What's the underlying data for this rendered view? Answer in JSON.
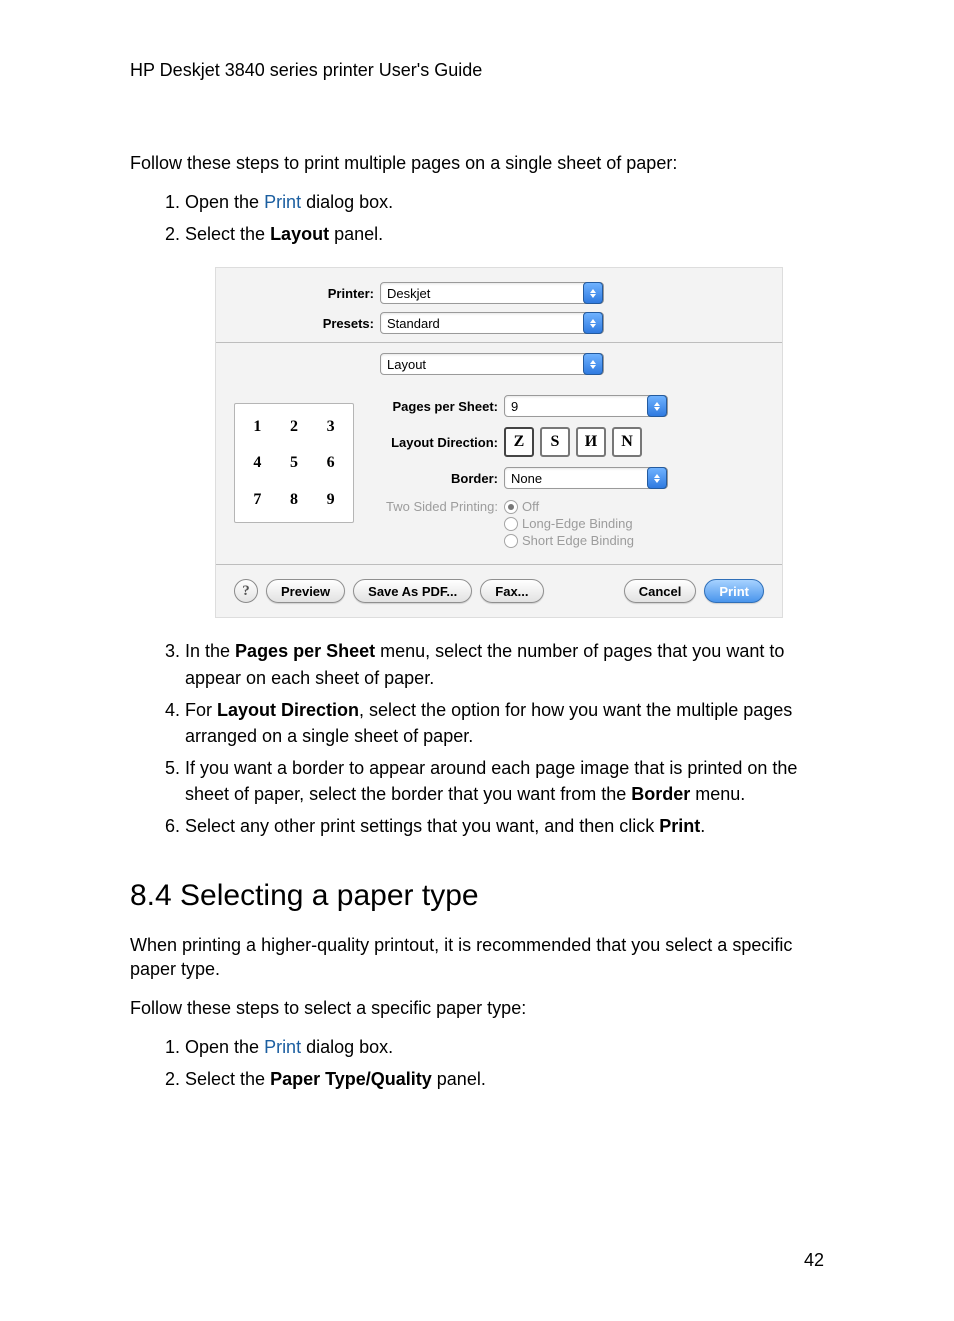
{
  "header": "HP Deskjet 3840 series printer User's Guide",
  "intro": "Follow these steps to print multiple pages on a single sheet of paper:",
  "steps_a": {
    "s1_a": "Open the ",
    "s1_link": "Print",
    "s1_b": " dialog box.",
    "s2_a": "Select the ",
    "s2_bold": "Layout",
    "s2_b": " panel."
  },
  "dialog": {
    "printer_label": "Printer:",
    "printer_value": "Deskjet",
    "presets_label": "Presets:",
    "presets_value": "Standard",
    "panel_value": "Layout",
    "pps_label": "Pages per Sheet:",
    "pps_value": "9",
    "dir_label": "Layout Direction:",
    "border_label": "Border:",
    "border_value": "None",
    "twosided_label": "Two Sided Printing:",
    "radio_off": "Off",
    "radio_long": "Long-Edge Binding",
    "radio_short": "Short Edge Binding",
    "help": "?",
    "btn_preview": "Preview",
    "btn_pdf": "Save As PDF...",
    "btn_fax": "Fax...",
    "btn_cancel": "Cancel",
    "btn_print": "Print",
    "preview_cells": [
      "1",
      "2",
      "3",
      "4",
      "5",
      "6",
      "7",
      "8",
      "9"
    ],
    "dir_icons": [
      "Z",
      "S",
      "И",
      "N"
    ]
  },
  "steps_b": {
    "s3_a": "In the ",
    "s3_bold": "Pages per Sheet",
    "s3_b": " menu, select the number of pages that you want to appear on each sheet of paper.",
    "s4_a": "For ",
    "s4_bold": "Layout Direction",
    "s4_b": ", select the option for how you want the multiple pages arranged on a single sheet of paper.",
    "s5_a": "If you want a border to appear around each page image that is printed on the sheet of paper, select the border that you want from the ",
    "s5_bold": "Border",
    "s5_b": " menu.",
    "s6_a": "Select any other print settings that you want, and then click ",
    "s6_bold": "Print",
    "s6_b": "."
  },
  "section": {
    "title": "8.4  Selecting a paper type",
    "p1": "When printing a higher-quality printout, it is recommended that you select a specific paper type.",
    "p2": "Follow these steps to select a specific paper type:"
  },
  "steps_c": {
    "s1_a": "Open the ",
    "s1_link": "Print",
    "s1_b": " dialog box.",
    "s2_a": "Select the ",
    "s2_bold": "Paper Type/Quality",
    "s2_b": " panel."
  },
  "page_number": "42"
}
